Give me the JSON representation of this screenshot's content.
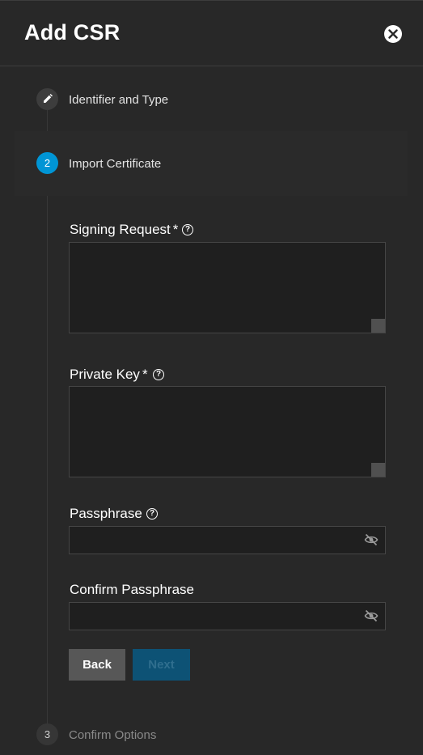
{
  "dialog": {
    "title": "Add CSR",
    "close_icon": "close-icon"
  },
  "steps": [
    {
      "number": "",
      "icon": "pencil-icon",
      "label": "Identifier and Type",
      "state": "completed"
    },
    {
      "number": "2",
      "label": "Import Certificate",
      "state": "active"
    },
    {
      "number": "3",
      "label": "Confirm Options",
      "state": "pending"
    }
  ],
  "form": {
    "signing_request": {
      "label": "Signing Request",
      "required_mark": "*",
      "value": "",
      "help_icon": "help-circle-icon"
    },
    "private_key": {
      "label": "Private Key",
      "required_mark": "*",
      "value": "",
      "help_icon": "help-circle-icon"
    },
    "passphrase": {
      "label": "Passphrase",
      "value": "",
      "help_icon": "help-circle-icon",
      "toggle_icon": "eye-off-icon"
    },
    "confirm_passphrase": {
      "label": "Confirm Passphrase",
      "value": "",
      "toggle_icon": "eye-off-icon"
    }
  },
  "buttons": {
    "back": "Back",
    "next": "Next"
  },
  "colors": {
    "background": "#282828",
    "active_step": "#0095d5",
    "next_disabled": "#0d5275"
  }
}
